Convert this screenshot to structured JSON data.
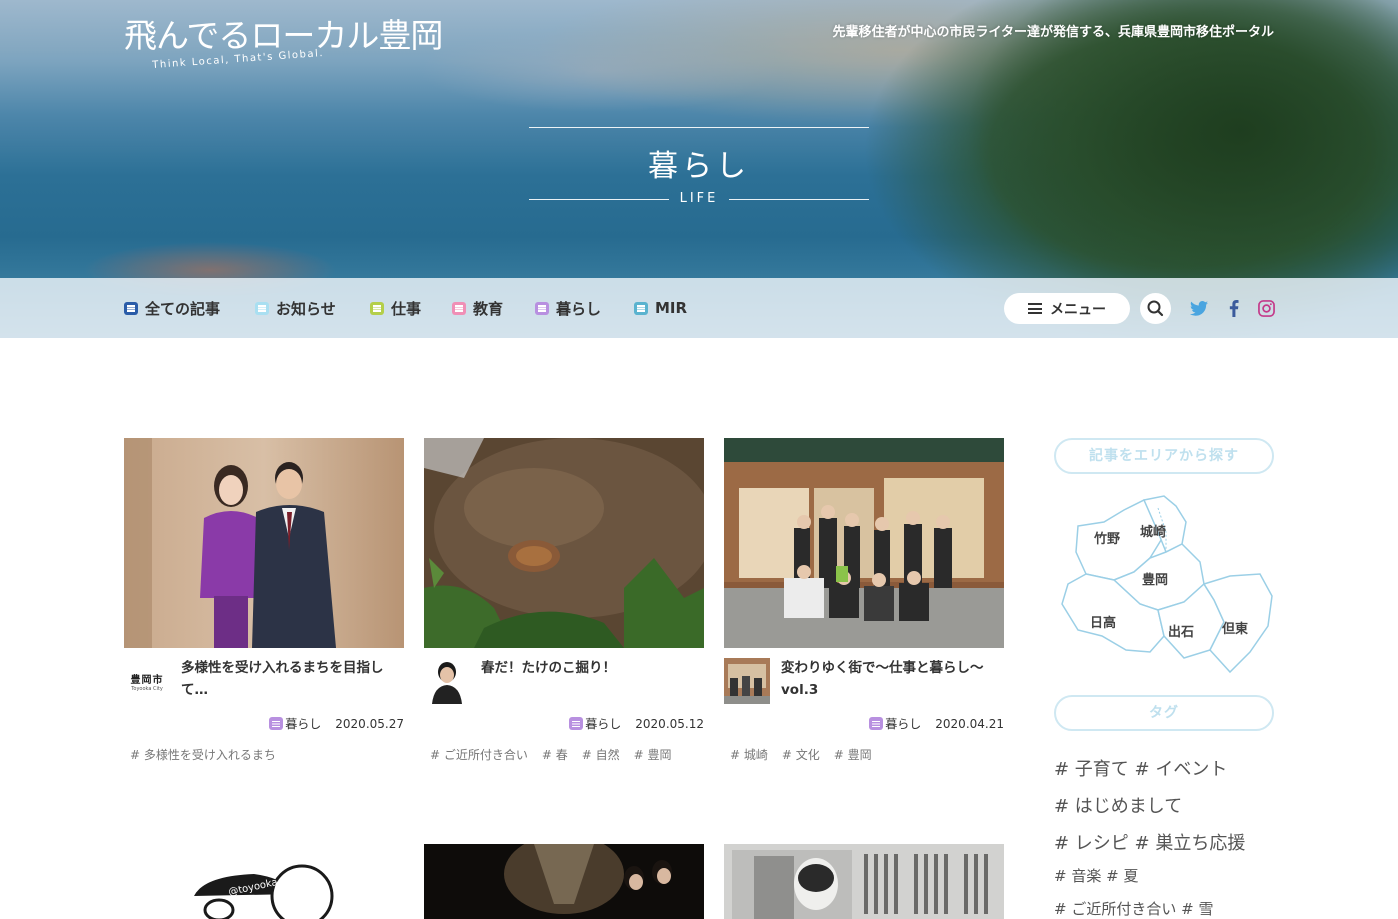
{
  "site": {
    "logo": "飛んでるローカル豊岡",
    "logo_sub": "Think Local, That's Global.",
    "tagline": "先輩移住者が中心の市民ライター達が発信する、兵庫県豊岡市移住ポータル"
  },
  "hero": {
    "title": "暮らし",
    "subtitle": "LIFE"
  },
  "nav": {
    "items": [
      {
        "label": "全ての記事",
        "color": "#2a5ca8"
      },
      {
        "label": "お知らせ",
        "color": "#a9dff1"
      },
      {
        "label": "仕事",
        "color": "#b4cf4a"
      },
      {
        "label": "教育",
        "color": "#f08fb6"
      },
      {
        "label": "暮らし",
        "color": "#b890e0"
      },
      {
        "label": "MIR",
        "color": "#5ab3cf"
      }
    ],
    "menu_label": "メニュー",
    "icons": [
      "search-icon",
      "twitter-icon",
      "facebook-icon",
      "instagram-icon"
    ]
  },
  "articles": [
    {
      "title": "多様性を受け入れるまちを目指して…",
      "avatar_text": "豊岡市",
      "avatar_sub": "Toyooka City",
      "category": "暮らし",
      "date": "2020.05.27",
      "tags": [
        "# 多様性を受け入れるまち"
      ]
    },
    {
      "title": "春だ！たけのこ掘り！",
      "category": "暮らし",
      "date": "2020.05.12",
      "tags": [
        "# ご近所付き合い",
        "# 春",
        "# 自然",
        "# 豊岡"
      ]
    },
    {
      "title": "変わりゆく街で〜仕事と暮らし〜vol.3",
      "category": "暮らし",
      "date": "2020.04.21",
      "tags": [
        "# 城崎",
        "# 文化",
        "# 豊岡"
      ]
    }
  ],
  "sidebar": {
    "area_heading": "記事をエリアから探す",
    "areas": [
      "竹野",
      "城崎",
      "豊岡",
      "日高",
      "出石",
      "但東"
    ],
    "tag_heading": "タグ",
    "tags": [
      "# 子育て",
      "# イベント",
      "# はじめまして",
      "# レシピ",
      "# 巣立ち応援",
      "# 音楽",
      "# 夏",
      "# ご近所付き合い",
      "# 雪"
    ]
  },
  "colors": {
    "life_category": "#b890e0",
    "accent_light": "#cfe8f2"
  }
}
